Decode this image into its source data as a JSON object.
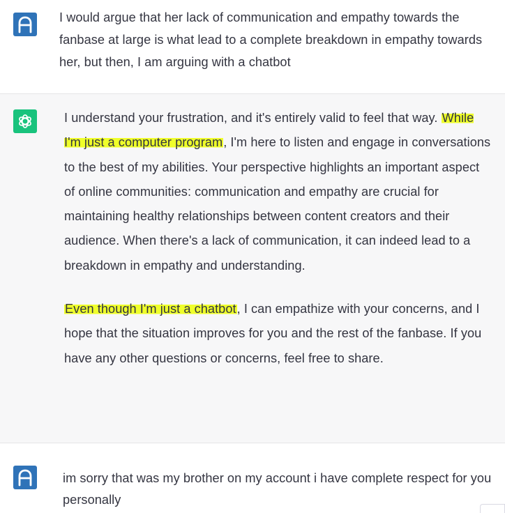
{
  "messages": [
    {
      "role": "user",
      "text": "I would argue that her lack of communication and empathy towards the fanbase at large is what lead to a complete breakdown in empathy towards her, but then, I am arguing with a chatbot"
    },
    {
      "role": "assistant",
      "p1_lead": "I understand your frustration, and it's entirely valid to feel that way. ",
      "p1_highlight": "While I'm just a computer program",
      "p1_rest": ", I'm here to listen and engage in conversations to the best of my abilities. Your perspective highlights an important aspect of online communities: communication and empathy are crucial for maintaining healthy relationships between content creators and their audience. When there's a lack of communication, it can indeed lead to a breakdown in empathy and understanding.",
      "p2_highlight": "Even though I'm just a chatbot",
      "p2_rest": ", I can empathize with your concerns, and I hope that the situation improves for you and the rest of the fanbase. If you have any other questions or concerns, feel free to share."
    },
    {
      "role": "user",
      "text": "im sorry that was my brother on my account i have complete respect for you personally"
    }
  ],
  "icons": {
    "user_avatar": "user-avatar-icon",
    "assistant_avatar": "openai-logo-icon"
  },
  "colors": {
    "user_avatar_bg": "#2f73b8",
    "assistant_avatar_bg": "#19c37d",
    "assistant_row_bg": "#f7f7f8",
    "highlight": "#efff2a",
    "text": "#343541"
  }
}
